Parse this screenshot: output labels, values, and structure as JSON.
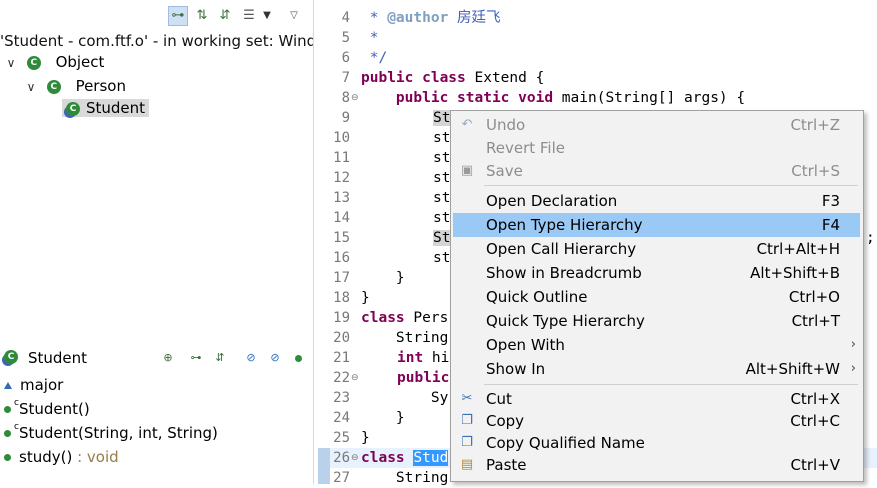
{
  "hierarchy": {
    "title": "'Student - com.ftf.o' - in working set: Windo",
    "tree": [
      {
        "label": "Object"
      },
      {
        "label": "Person"
      },
      {
        "label": "Student"
      }
    ]
  },
  "members": {
    "title": "Student",
    "items": [
      {
        "name": "major",
        "type": ""
      },
      {
        "name": "Student()",
        "type": ""
      },
      {
        "name": "Student(String, int, String)",
        "type": ""
      },
      {
        "name": "study()",
        "type": " : void"
      }
    ],
    "constructor_marker": "c"
  },
  "editor": {
    "line_numbers": [
      "4",
      "5",
      "6",
      "7",
      "8",
      "9",
      "10",
      "11",
      "12",
      "13",
      "14",
      "15",
      "16",
      "17",
      "18",
      "19",
      "20",
      "21",
      "22",
      "23",
      "24",
      "25",
      "26",
      "27"
    ],
    "lines": {
      "l4_star": " * ",
      "l4_tag": "@author",
      "l4_text": " 房廷飞",
      "l5": " *",
      "l6": " */",
      "l7_kw": "public class",
      "l7_text": " Extend {",
      "l8_indent": "    ",
      "l8_kw": "public static void",
      "l8_text": " main(String[] args) {",
      "l9": "St",
      "l10": "st",
      "l11": "st",
      "l12": "st",
      "l13": "st",
      "l14": "st",
      "l15": "St",
      "l15_tail": ";",
      "l16": "st",
      "l17": "    }",
      "l18": "}",
      "l19_kw": "class",
      "l19_text": " Pers",
      "l20": "    String",
      "l21_kw": "int",
      "l21_text": " hi",
      "l22_kw": "public",
      "l23": "        Sy",
      "l24": "    }",
      "l25": "}",
      "l26_kw": "class",
      "l26_sel": "Stud",
      "l27": "    String"
    }
  },
  "context_menu": {
    "items": [
      {
        "label": "Undo",
        "shortcut": "Ctrl+Z",
        "icon": "undo-icon"
      },
      {
        "label": "Revert File",
        "shortcut": ""
      },
      {
        "label": "Save",
        "shortcut": "Ctrl+S",
        "icon": "save-icon"
      },
      {
        "label": "Open Declaration",
        "shortcut": "F3"
      },
      {
        "label": "Open Type Hierarchy",
        "shortcut": "F4"
      },
      {
        "label": "Open Call Hierarchy",
        "shortcut": "Ctrl+Alt+H"
      },
      {
        "label": "Show in Breadcrumb",
        "shortcut": "Alt+Shift+B"
      },
      {
        "label": "Quick Outline",
        "shortcut": "Ctrl+O"
      },
      {
        "label": "Quick Type Hierarchy",
        "shortcut": "Ctrl+T"
      },
      {
        "label": "Open With",
        "shortcut": ""
      },
      {
        "label": "Show In",
        "shortcut": "Alt+Shift+W"
      },
      {
        "label": "Cut",
        "shortcut": "Ctrl+X",
        "icon": "scissors-icon"
      },
      {
        "label": "Copy",
        "shortcut": "Ctrl+C",
        "icon": "copy-icon"
      },
      {
        "label": "Copy Qualified Name",
        "shortcut": "",
        "icon": "copy-qualified-icon"
      },
      {
        "label": "Paste",
        "shortcut": "Ctrl+V",
        "icon": "paste-icon"
      }
    ],
    "submenu_arrow": "›"
  },
  "colors": {
    "keyword": "#7f0055",
    "comment": "#3f5fbf",
    "menu_highlight": "#99c9f4",
    "selection": "#3399ff",
    "class_icon": "#2e8b3a"
  }
}
